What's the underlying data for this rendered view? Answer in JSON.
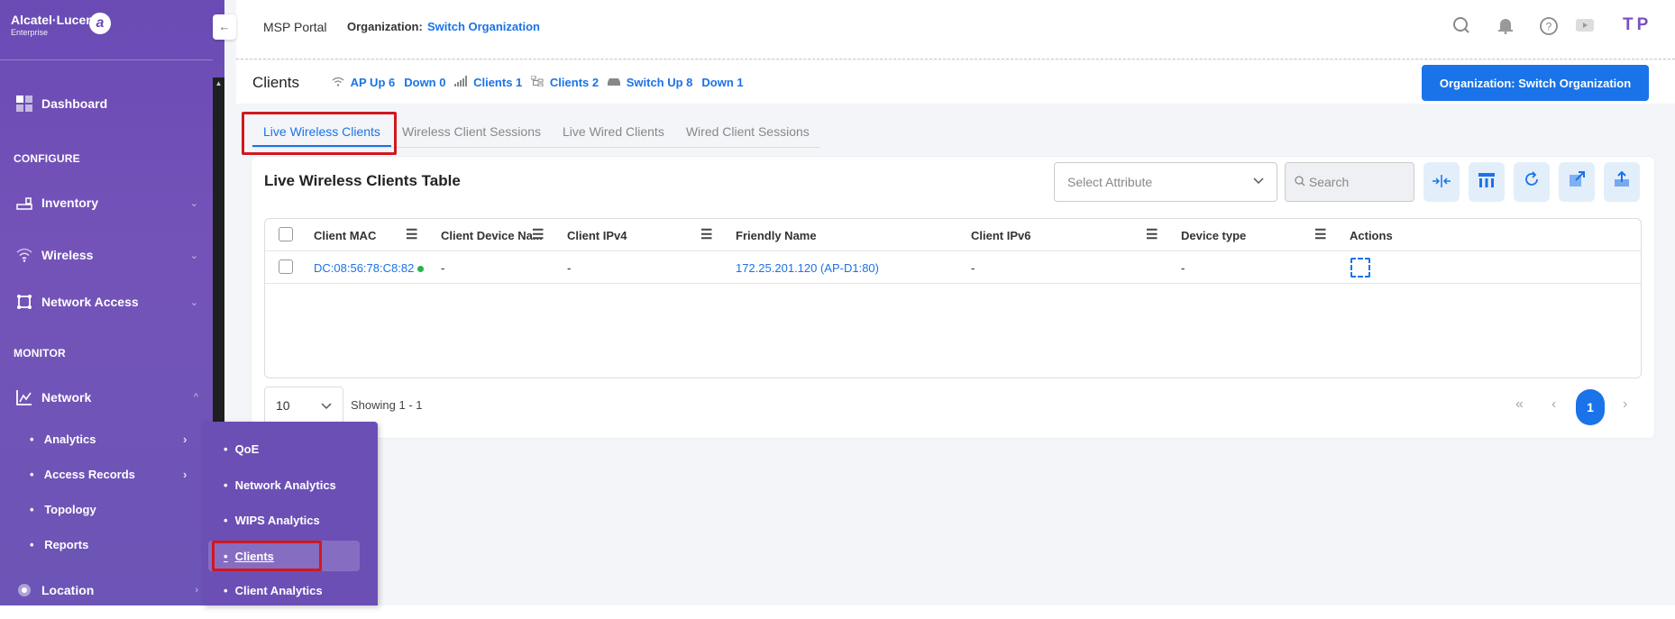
{
  "sidebar": {
    "brand": "Alcatel·Lucent",
    "brand_sub": "Enterprise",
    "brand_mark": "a",
    "collapse_icon": "←",
    "dashboard": "Dashboard",
    "configure_label": "CONFIGURE",
    "inventory": "Inventory",
    "wireless": "Wireless",
    "network_access": "Network Access",
    "monitor_label": "MONITOR",
    "network": "Network",
    "network_sub": [
      "Analytics",
      "Access Records",
      "Topology",
      "Reports"
    ],
    "location": "Location"
  },
  "flyout": {
    "items": [
      "QoE",
      "Network Analytics",
      "WIPS Analytics",
      "Clients",
      "Client Analytics"
    ],
    "active": "Clients"
  },
  "topbar": {
    "portal": "MSP Portal",
    "org_label": "Organization:",
    "org_link": "Switch Organization",
    "user_initials": "TP"
  },
  "header": {
    "title": "Clients",
    "stats": {
      "ap_up": "AP  Up 6",
      "ap_down": "Down 0",
      "clients_wifi": "Clients 1",
      "clients_wired": "Clients 2",
      "switch_up": "Switch Up 8",
      "switch_down": "Down 1"
    },
    "org_button": "Organization: Switch Organization"
  },
  "tabs": [
    "Live Wireless Clients",
    "Wireless Client Sessions",
    "Live Wired Clients",
    "Wired Client Sessions"
  ],
  "card": {
    "title": "Live Wireless Clients Table",
    "select_placeholder": "Select Attribute",
    "search_placeholder": "Search"
  },
  "table": {
    "columns": [
      "Client MAC",
      "Client Device Na...",
      "Client IPv4",
      "Friendly Name",
      "Client IPv6",
      "Device type",
      "Actions"
    ],
    "rows": [
      {
        "mac": "DC:08:56:78:C8:82",
        "device_name": "-",
        "ipv4": "-",
        "friendly": "172.25.201.120 (AP-D1:80)",
        "ipv6": "-",
        "device_type": "-"
      }
    ]
  },
  "footer": {
    "page_size": "10",
    "showing": "Showing 1 - 1",
    "current_page": "1"
  },
  "colors": {
    "accent": "#1a73e8",
    "sidebar": "#6a4bb5",
    "highlight": "#d0181f",
    "online": "#29b34a"
  }
}
